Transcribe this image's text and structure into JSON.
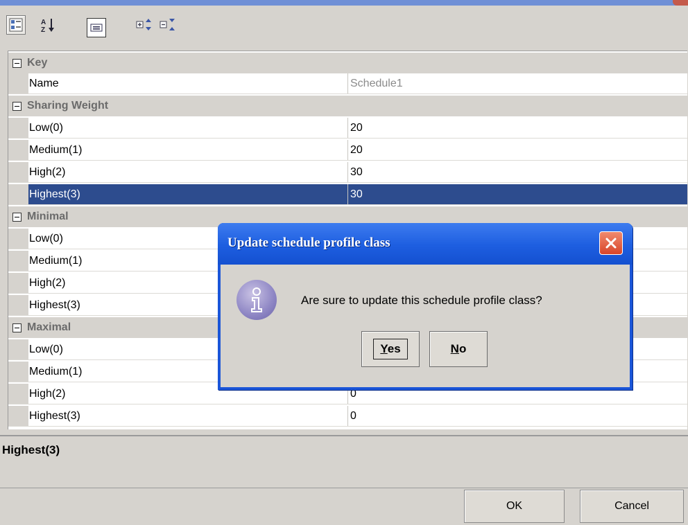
{
  "toolbar": {
    "buttons": [
      {
        "name": "categorized-view-icon"
      },
      {
        "name": "sort-alphabetical-icon"
      },
      {
        "name": "property-pages-icon"
      },
      {
        "name": "expand-all-icon"
      },
      {
        "name": "collapse-all-icon"
      }
    ]
  },
  "grid": {
    "categories": [
      {
        "label": "Key",
        "props": [
          {
            "name": "Name",
            "value": "Schedule1"
          }
        ]
      },
      {
        "label": "Sharing Weight",
        "props": [
          {
            "name": "Low(0)",
            "value": "20"
          },
          {
            "name": "Medium(1)",
            "value": "20"
          },
          {
            "name": "High(2)",
            "value": "30"
          },
          {
            "name": "Highest(3)",
            "value": "30"
          }
        ]
      },
      {
        "label": "Minimal",
        "props": [
          {
            "name": "Low(0)",
            "value": ""
          },
          {
            "name": "Medium(1)",
            "value": ""
          },
          {
            "name": "High(2)",
            "value": ""
          },
          {
            "name": "Highest(3)",
            "value": ""
          }
        ]
      },
      {
        "label": "Maximal",
        "props": [
          {
            "name": "Low(0)",
            "value": ""
          },
          {
            "name": "Medium(1)",
            "value": ""
          },
          {
            "name": "High(2)",
            "value": "0"
          },
          {
            "name": "Highest(3)",
            "value": "0"
          }
        ]
      }
    ]
  },
  "description": {
    "title": "Highest(3)"
  },
  "buttons": {
    "ok": "OK",
    "cancel": "Cancel"
  },
  "dialog": {
    "title": "Update schedule profile class",
    "message": "Are sure to update this schedule profile class?",
    "yes_rest": "es",
    "yes_mnemonic": "Y",
    "no_rest": "o",
    "no_mnemonic": "N"
  },
  "colors": {
    "selection": "#2d4c8e",
    "dialog_title": "#1d5ee0",
    "close_red": "#d8452a"
  }
}
